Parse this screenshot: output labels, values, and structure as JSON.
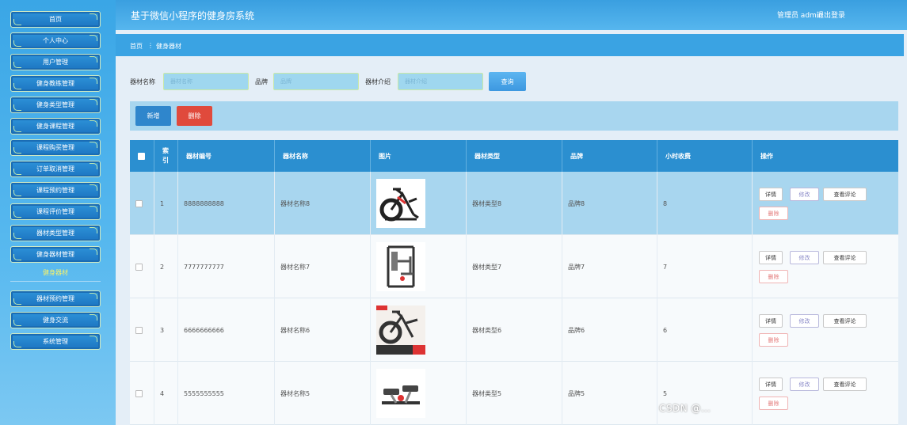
{
  "app": {
    "title": "基于微信小程序的健身房系统",
    "user_label": "管理员 admin",
    "logout_label": "退出登录"
  },
  "sidebar": {
    "items": [
      {
        "label": "首页"
      },
      {
        "label": "个人中心"
      },
      {
        "label": "用户管理"
      },
      {
        "label": "健身教练管理"
      },
      {
        "label": "健身类型管理"
      },
      {
        "label": "健身课程管理"
      },
      {
        "label": "课程购买管理"
      },
      {
        "label": "订单取消管理"
      },
      {
        "label": "课程预约管理"
      },
      {
        "label": "课程评价管理"
      },
      {
        "label": "器材类型管理"
      },
      {
        "label": "健身器材管理"
      }
    ],
    "active_sub": "健身器材",
    "items_after": [
      {
        "label": "器材预约管理"
      },
      {
        "label": "健身交流"
      },
      {
        "label": "系统管理"
      }
    ]
  },
  "breadcrumb": {
    "home": "首页",
    "separator": "⋮",
    "current": "健身器材"
  },
  "search": {
    "name_label": "器材名称",
    "name_placeholder": "器材名称",
    "brand_label": "品牌",
    "brand_placeholder": "品牌",
    "intro_label": "器材介绍",
    "intro_placeholder": "器材介绍",
    "query_label": "查询"
  },
  "actions": {
    "add_label": "新增",
    "delete_label": "删除"
  },
  "table": {
    "headers": [
      "索引",
      "器材编号",
      "器材名称",
      "图片",
      "器材类型",
      "品牌",
      "小时收费",
      "操作"
    ],
    "index_header_line1": "索",
    "index_header_line2": "引",
    "rows": [
      {
        "index": "1",
        "code": "8888888888",
        "name": "器材名称8",
        "type": "器材类型8",
        "brand": "品牌8",
        "fee": "8",
        "image": "exercise-bike"
      },
      {
        "index": "2",
        "code": "7777777777",
        "name": "器材名称7",
        "type": "器材类型7",
        "brand": "品牌7",
        "fee": "7",
        "image": "strength-machine"
      },
      {
        "index": "3",
        "code": "6666666666",
        "name": "器材名称6",
        "type": "器材类型6",
        "brand": "品牌6",
        "fee": "6",
        "image": "spin-bike"
      },
      {
        "index": "4",
        "code": "5555555555",
        "name": "器材名称5",
        "type": "器材类型5",
        "brand": "品牌5",
        "fee": "5",
        "image": "stepper"
      }
    ],
    "op_labels": {
      "detail": "详情",
      "edit": "修改",
      "reviews": "查看评论",
      "remove": "删除"
    }
  },
  "watermark": "CSDN @…",
  "colors": {
    "sidebar": "#3aa6e6",
    "header": "#3a9fe0",
    "table_header": "#2b8fd0",
    "row_highlight": "#a8d6ef",
    "delete": "#e04a3c",
    "add": "#2f86cc"
  }
}
